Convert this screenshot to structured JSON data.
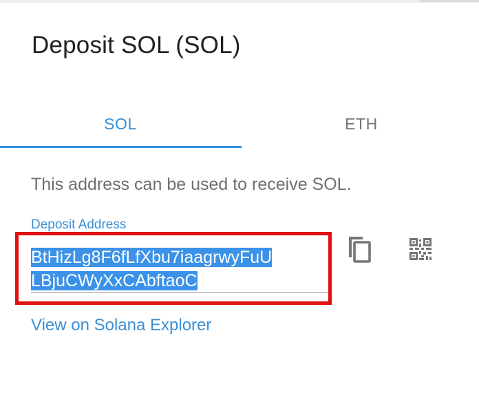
{
  "dialog": {
    "title": "Deposit SOL (SOL)"
  },
  "tabs": [
    {
      "label": "SOL",
      "selected": true
    },
    {
      "label": "ETH",
      "selected": false
    }
  ],
  "info_text": "This address can be used to receive SOL.",
  "deposit": {
    "label": "Deposit Address",
    "address_line1": "BtHizLg8F6fLfXbu7iaagrwyFuU",
    "address_line2": "LBjuCWyXxCAbftaoC"
  },
  "actions": {
    "copy_icon": "copy-icon",
    "qr_icon": "qr-code-icon",
    "explorer_link": "View on Solana Explorer"
  },
  "colors": {
    "accent": "#2f8fd8",
    "selection": "#3b92e8",
    "highlight_border": "#e01010"
  }
}
